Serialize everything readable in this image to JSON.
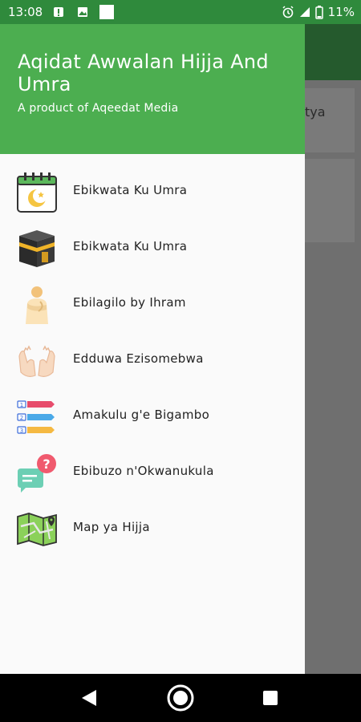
{
  "status_bar": {
    "time": "13:08",
    "battery": "11%",
    "left_icons": [
      "notification-icon",
      "image-icon",
      "square-icon"
    ],
    "right_icons": [
      "alarm-icon",
      "signal-icon",
      "battery-icon"
    ]
  },
  "background": {
    "partial_text": "tya"
  },
  "drawer": {
    "title": "Aqidat Awwalan Hijja And Umra",
    "subtitle": "A product of Aqeedat Media",
    "items": [
      {
        "label": "Ebikwata Ku Umra",
        "icon": "calendar-moon-icon"
      },
      {
        "label": "Ebikwata Ku Umra",
        "icon": "kaaba-icon"
      },
      {
        "label": "Ebilagilo by Ihram",
        "icon": "ihram-icon"
      },
      {
        "label": "Edduwa Ezisomebwa",
        "icon": "praying-hands-icon"
      },
      {
        "label": "Amakulu g'e Bigambo",
        "icon": "numbered-list-icon"
      },
      {
        "label": "Ebibuzo n'Okwanukula",
        "icon": "question-chat-icon"
      },
      {
        "label": "Map ya Hijja",
        "icon": "map-icon"
      }
    ]
  },
  "colors": {
    "header_green": "#4cae50",
    "status_green": "#2f8a3c",
    "toolbar_dim": "#255a2d"
  }
}
